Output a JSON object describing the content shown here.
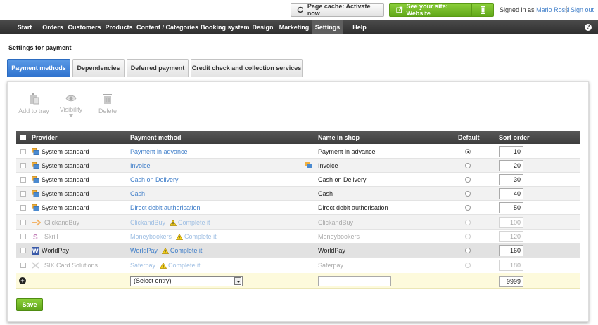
{
  "topbar": {
    "cache_button": "Page cache: Activate now",
    "site_button": "See your site: Website",
    "signed_in_as": "Signed in as",
    "user_name": "Mario Rossi",
    "sign_out": "Sign out"
  },
  "nav": {
    "items": [
      "Start",
      "Orders",
      "Customers",
      "Products",
      "Content / Categories",
      "Booking system",
      "Design",
      "Marketing",
      "Settings",
      "Help"
    ],
    "active": "Settings",
    "help_icon": "?"
  },
  "page": {
    "title": "Settings for payment",
    "tabs": [
      "Payment methods",
      "Dependencies",
      "Deferred payment",
      "Credit check and collection services"
    ],
    "active_tab": "Payment methods"
  },
  "toolbar": {
    "add_to_tray": "Add to tray",
    "visibility": "Visibility",
    "delete": "Delete"
  },
  "table": {
    "headers": {
      "provider": "Provider",
      "payment_method": "Payment method",
      "name_in_shop": "Name in shop",
      "default": "Default",
      "sort_order": "Sort order"
    },
    "rows": [
      {
        "provider": "System standard",
        "method": "Payment in advance",
        "shop_name": "Payment in advance",
        "default": true,
        "sort": "10",
        "enabled": true,
        "warning": ""
      },
      {
        "provider": "System standard",
        "method": "Invoice",
        "shop_name": "Invoice",
        "default": false,
        "sort": "20",
        "enabled": true,
        "warning": ""
      },
      {
        "provider": "System standard",
        "method": "Cash on Delivery",
        "shop_name": "Cash on Delivery",
        "default": false,
        "sort": "30",
        "enabled": true,
        "warning": ""
      },
      {
        "provider": "System standard",
        "method": "Cash",
        "shop_name": "Cash",
        "default": false,
        "sort": "40",
        "enabled": true,
        "warning": ""
      },
      {
        "provider": "System standard",
        "method": "Direct debit authorisation",
        "shop_name": "Direct debit authorisation",
        "default": false,
        "sort": "50",
        "enabled": true,
        "warning": ""
      },
      {
        "provider": "ClickandBuy",
        "method": "ClickandBuy",
        "shop_name": "ClickandBuy",
        "default": false,
        "sort": "100",
        "enabled": false,
        "warning": "Complete it"
      },
      {
        "provider": "Skrill",
        "method": "Moneybookers",
        "shop_name": "Moneybookers",
        "default": false,
        "sort": "120",
        "enabled": false,
        "warning": "Complete it"
      },
      {
        "provider": "WorldPay",
        "method": "WorldPay",
        "shop_name": "WorldPay",
        "default": false,
        "sort": "160",
        "enabled": true,
        "warning": "Complete it"
      },
      {
        "provider": "SIX Card Solutions",
        "method": "Saferpay",
        "shop_name": "Saferpay",
        "default": false,
        "sort": "180",
        "enabled": false,
        "warning": "Complete it"
      }
    ],
    "new_row": {
      "select_placeholder": "(Select entry)",
      "sort": "9999"
    }
  },
  "save_button": "Save",
  "colors": {
    "accent_blue": "#2f73cf",
    "link": "#3f7ec9",
    "green": "#61a81a",
    "nav_dark": "#3a3a3a"
  }
}
